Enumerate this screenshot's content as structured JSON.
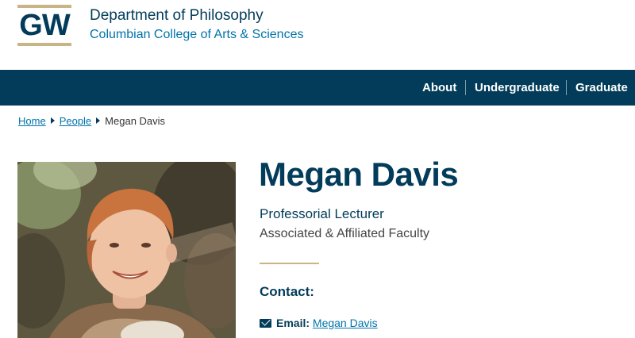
{
  "header": {
    "logo_text": "GW",
    "department": "Department of Philosophy",
    "college": "Columbian College of Arts & Sciences"
  },
  "nav": {
    "items": [
      {
        "label": "About"
      },
      {
        "label": "Undergraduate"
      },
      {
        "label": "Graduate"
      }
    ]
  },
  "breadcrumb": {
    "home": "Home",
    "people": "People",
    "current": "Megan Davis"
  },
  "profile": {
    "name": "Megan Davis",
    "title": "Professorial Lecturer",
    "group": "Associated & Affiliated Faculty",
    "contact_heading": "Contact:",
    "email_label": "Email:",
    "email_link_text": "Megan Davis"
  },
  "colors": {
    "brand_blue": "#033c5a",
    "link_blue": "#0073aa",
    "gold": "#c9b486"
  },
  "icons": {
    "email": "envelope-icon",
    "breadcrumb_separator": "triangle-right-icon"
  }
}
